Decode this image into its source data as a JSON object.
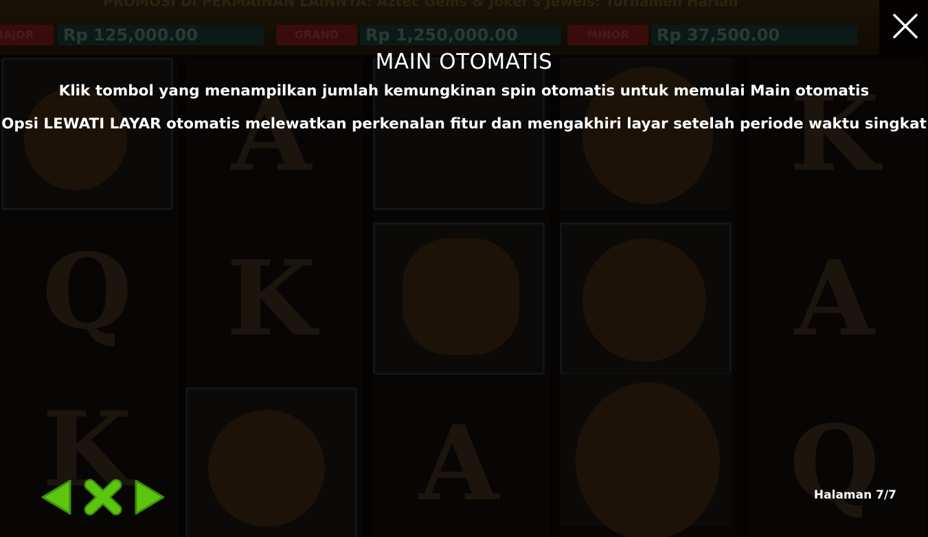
{
  "background": {
    "ticker_text": "PROMOSI DI PERMAINAN LAINNYA: Aztec Gems & Joker's Jewels: Turnamen Harian",
    "jackpots": [
      {
        "tag": "MAJOR",
        "amount": "Rp 125,000.00"
      },
      {
        "tag": "GRAND",
        "amount": "Rp 1,250,000.00"
      },
      {
        "tag": "MINOR",
        "amount": "Rp 37,500.00"
      }
    ]
  },
  "info": {
    "title": "MAIN OTOMATIS",
    "line1": "Klik tombol yang menampilkan jumlah kemungkinan spin otomatis untuk memulai Main otomatis",
    "line2": "Opsi LEWATI LAYAR otomatis melewatkan perkenalan fitur dan mengakhiri layar setelah periode waktu singkat"
  },
  "footer": {
    "page_label": "Halaman 7/7"
  },
  "colors": {
    "accent_green": "#5cc60f",
    "accent_green_dark": "#3c8f08",
    "text": "#ffffff"
  },
  "icons": {
    "close": "close-icon",
    "prev": "arrow-left-icon",
    "exit": "x-icon",
    "next": "arrow-right-icon"
  }
}
